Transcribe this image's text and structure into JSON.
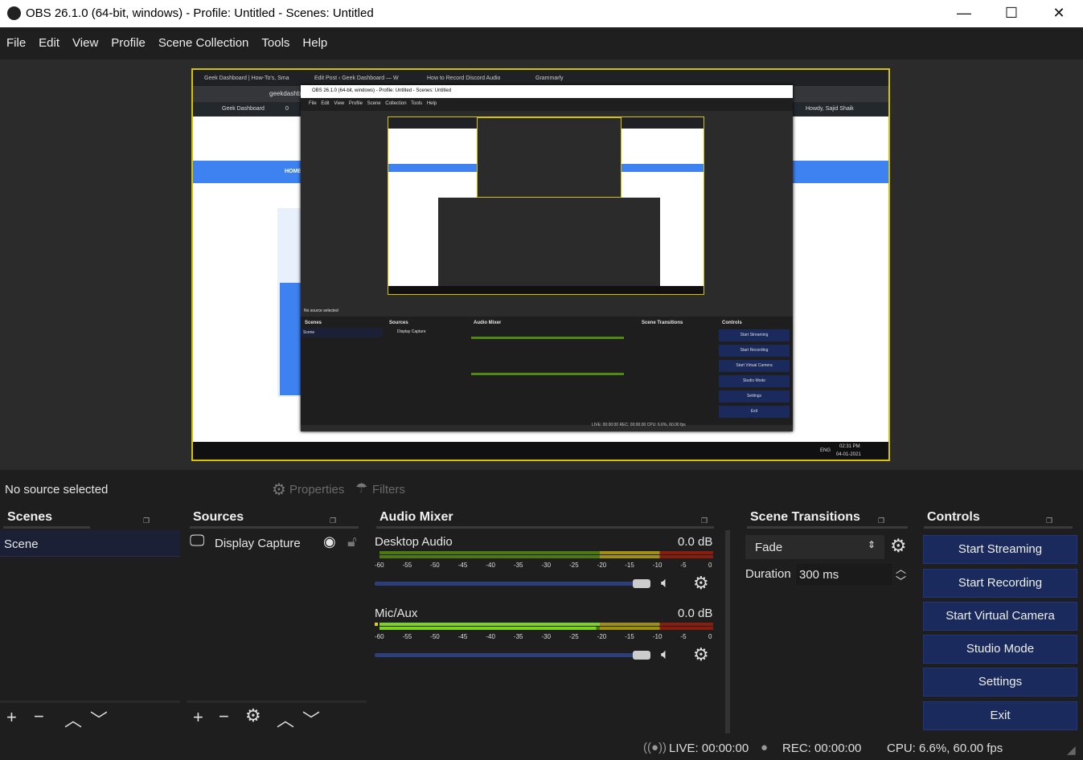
{
  "window": {
    "title": "OBS 26.1.0 (64-bit, windows) - Profile: Untitled - Scenes: Untitled",
    "minimize": "—",
    "maximize": "☐",
    "close": "✕"
  },
  "menu": [
    "File",
    "Edit",
    "View",
    "Profile",
    "Scene Collection",
    "Tools",
    "Help"
  ],
  "preview": {
    "browser_tabs": [
      "Geek Dashboard | How-To's, Sma",
      "Edit Post ‹ Geek Dashboard — W",
      "How to Record Discord Audio",
      "Grammarly"
    ],
    "address": "geekdashb",
    "wp_site": "Geek Dashboard",
    "wp_comments": "0",
    "wp_user": "Howdy, Sajid Shaik",
    "nav_item": "HOME",
    "inner_title": "OBS 26.1.0 (64-bit, windows) - Profile: Untitled - Scenes: Untitled",
    "inner_menu": "File Edit View Profile Scene Collection Tools Help",
    "inner_nosrc": "No source selected",
    "inner_docks": [
      "Scenes",
      "Sources",
      "Audio Mixer",
      "Scene Transitions",
      "Controls"
    ],
    "inner_scene": "Scene",
    "inner_source": "Display Capture",
    "inner_buttons": [
      "Start Streaming",
      "Start Recording",
      "Start Virtual Camera",
      "Studio Mode",
      "Settings",
      "Exit"
    ],
    "inner_status": "LIVE: 00:00:00   REC: 00:00:00   CPU: 6.6%, 60.00 fps",
    "taskbar_lang": "ENG",
    "taskbar_time": "02:31 PM",
    "taskbar_date": "04-01-2021"
  },
  "source_bar": {
    "status": "No source selected",
    "properties": "Properties",
    "filters": "Filters"
  },
  "scenes": {
    "title": "Scenes",
    "items": [
      "Scene"
    ],
    "selected": 0
  },
  "sources": {
    "title": "Sources",
    "items": [
      {
        "name": "Display Capture",
        "visible": true,
        "locked": false
      }
    ]
  },
  "audio_mixer": {
    "title": "Audio Mixer",
    "scale": [
      "-60",
      "-55",
      "-50",
      "-45",
      "-40",
      "-35",
      "-30",
      "-25",
      "-20",
      "-15",
      "-10",
      "-5",
      "0"
    ],
    "channels": [
      {
        "name": "Desktop Audio",
        "db": "0.0 dB",
        "volume_percent": 100,
        "level_db": null
      },
      {
        "name": "Mic/Aux",
        "db": "0.0 dB",
        "volume_percent": 100,
        "level_db": -20
      }
    ]
  },
  "transitions": {
    "title": "Scene Transitions",
    "selected": "Fade",
    "duration_label": "Duration",
    "duration_value": "300 ms"
  },
  "controls": {
    "title": "Controls",
    "buttons": [
      "Start Streaming",
      "Start Recording",
      "Start Virtual Camera",
      "Studio Mode",
      "Settings",
      "Exit"
    ]
  },
  "status": {
    "live": "LIVE: 00:00:00",
    "rec": "REC: 00:00:00",
    "cpu": "CPU: 6.6%, 60.00 fps"
  },
  "colors": {
    "accent_button": "#1b2a5c",
    "meter_green": "#4c8a10",
    "meter_yellow": "#a09012",
    "meter_red": "#8a1e0e",
    "preview_border": "#d7c400"
  }
}
